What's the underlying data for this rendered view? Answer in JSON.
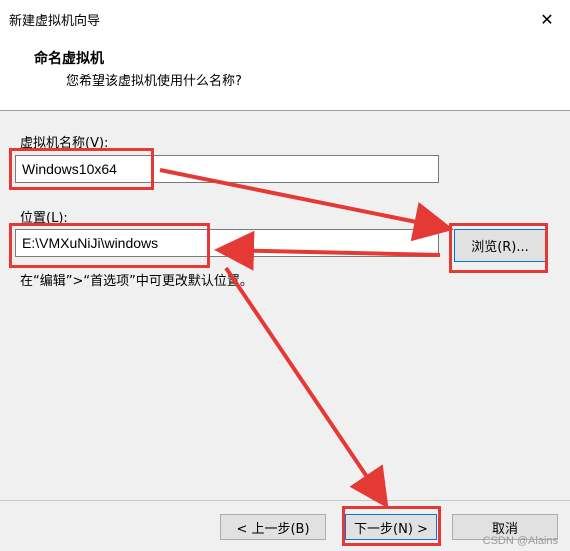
{
  "window": {
    "title": "新建虚拟机向导",
    "close_glyph": "✕"
  },
  "header": {
    "title": "命名虚拟机",
    "subtitle": "您希望该虚拟机使用什么名称?"
  },
  "form": {
    "name_label": "虚拟机名称(V):",
    "name_value": "Windows10x64",
    "location_label": "位置(L):",
    "location_value": "E:\\VMXuNiJi\\windows",
    "browse_label": "浏览(R)...",
    "hint": "在“编辑”>“首选项”中可更改默认位置。"
  },
  "footer": {
    "back_label": "< 上一步(B)",
    "next_label": "下一步(N) >",
    "cancel_label": "取消"
  },
  "watermark": "CSDN @Alains",
  "colors": {
    "annotation_red": "#e53935",
    "focus_blue": "#0078d7"
  }
}
